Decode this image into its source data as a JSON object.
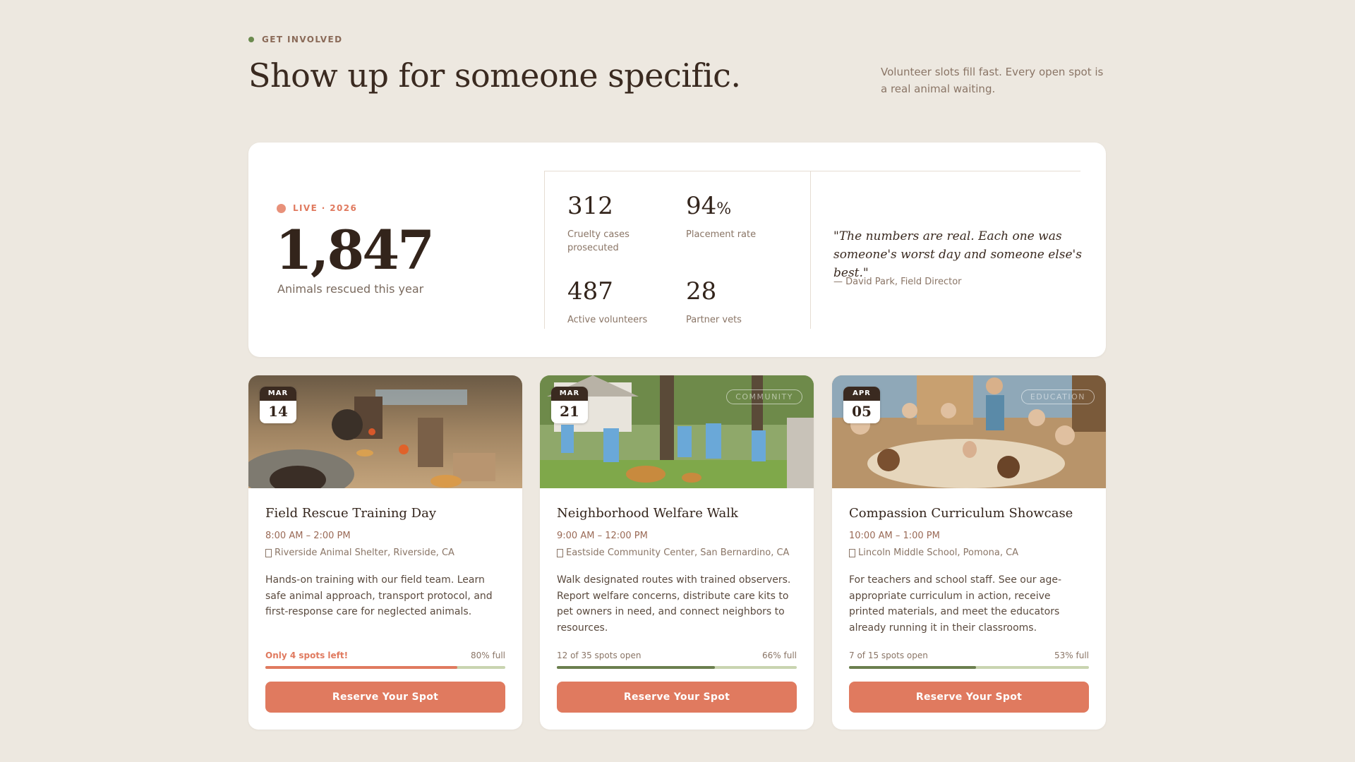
{
  "header": {
    "eyebrow": "GET INVOLVED",
    "headline": "Show up for someone specific.",
    "lede": "Volunteer slots fill fast. Every open spot is a real animal waiting."
  },
  "stats": {
    "live_label": "LIVE · 2026",
    "rescued_count": "1,847",
    "rescued_label": "Animals rescued this year",
    "items": [
      {
        "value": "312",
        "unit": "",
        "label": "Cruelty cases prosecuted"
      },
      {
        "value": "94",
        "unit": "%",
        "label": "Placement rate"
      },
      {
        "value": "487",
        "unit": "",
        "label": "Active volunteers"
      },
      {
        "value": "28",
        "unit": "",
        "label": "Partner vets"
      }
    ],
    "quote": "\"The numbers are real. Each one was someone's worst day and someone else's best.\"",
    "quote_by": "— David Park, Field Director"
  },
  "events": [
    {
      "month": "MAR",
      "day": "14",
      "tag": "",
      "title": "Field Rescue Training Day",
      "time": "8:00 AM – 2:00 PM",
      "location": "Riverside Animal Shelter, Riverside, CA",
      "description": "Hands-on training with our field team. Learn safe animal approach, transport protocol, and first-response care for neglected animals.",
      "availability": "Only 4 spots left!",
      "fill_label": "80% full",
      "fill_fraction": 0.8,
      "urgent": true,
      "button": "Reserve Your Spot"
    },
    {
      "month": "MAR",
      "day": "21",
      "tag": "COMMUNITY",
      "title": "Neighborhood Welfare Walk",
      "time": "9:00 AM – 12:00 PM",
      "location": "Eastside Community Center, San Bernardino, CA",
      "description": "Walk designated routes with trained observers. Report welfare concerns, distribute care kits to pet owners in need, and connect neighbors to resources.",
      "availability": "12 of 35 spots open",
      "fill_label": "66% full",
      "fill_fraction": 0.66,
      "urgent": false,
      "button": "Reserve Your Spot"
    },
    {
      "month": "APR",
      "day": "05",
      "tag": "EDUCATION",
      "title": "Compassion Curriculum Showcase",
      "time": "10:00 AM – 1:00 PM",
      "location": "Lincoln Middle School, Pomona, CA",
      "description": "For teachers and school staff. See our age-appropriate curriculum in action, receive printed materials, and meet the educators already running it in their classrooms.",
      "availability": "7 of 15 spots open",
      "fill_label": "53% full",
      "fill_fraction": 0.53,
      "urgent": false,
      "button": "Reserve Your Spot"
    }
  ],
  "colors": {
    "accent": "#e07a5f",
    "bar_fill_urgent": "#e07a5f",
    "bar_fill": "#6b7f4e",
    "bar_track": "#c9d4b0"
  },
  "icons": [
    "location-pin-icon"
  ]
}
